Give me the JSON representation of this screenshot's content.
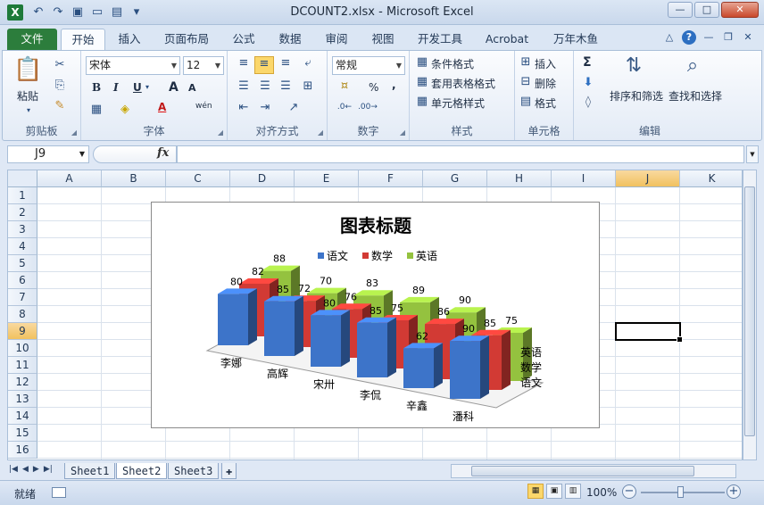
{
  "window": {
    "title": "DCOUNT2.xlsx  -  Microsoft Excel"
  },
  "ribbon_tabs": [
    "文件",
    "开始",
    "插入",
    "页面布局",
    "公式",
    "数据",
    "审阅",
    "视图",
    "开发工具",
    "Acrobat",
    "万年木鱼"
  ],
  "ribbon": {
    "clipboard": {
      "label": "剪贴板",
      "paste": "粘贴"
    },
    "font": {
      "label": "字体",
      "font_name": "宋体",
      "font_size": "12",
      "bold": "B",
      "italic": "I",
      "underline": "U",
      "grow": "A",
      "shrink": "A",
      "font_color_glyph": "A",
      "wen_glyph": "wén"
    },
    "alignment": {
      "label": "对齐方式"
    },
    "number": {
      "label": "数字",
      "format": "常规",
      "percent": "%",
      "comma": ","
    },
    "styles": {
      "label": "样式",
      "conditional": "条件格式",
      "table": "套用表格格式",
      "cell_styles": "单元格样式"
    },
    "cells": {
      "label": "单元格",
      "insert": "插入",
      "delete": "删除",
      "format": "格式"
    },
    "editing": {
      "label": "编辑",
      "sort": "排序和筛选",
      "find": "查找和选择",
      "sigma": "Σ"
    }
  },
  "formula_bar": {
    "name_box": "J9",
    "fx": "fx",
    "content": ""
  },
  "grid": {
    "columns": [
      "A",
      "B",
      "C",
      "D",
      "E",
      "F",
      "G",
      "H",
      "I",
      "J",
      "K"
    ],
    "rows": [
      "1",
      "2",
      "3",
      "4",
      "5",
      "6",
      "7",
      "8",
      "9",
      "10",
      "11",
      "12",
      "13",
      "14",
      "15",
      "16"
    ],
    "active_col": "J",
    "active_row": "9"
  },
  "chart_data": {
    "type": "bar",
    "title": "图表标题",
    "categories": [
      "李娜",
      "高辉",
      "宋卅",
      "李侃",
      "辛鑫",
      "潘科"
    ],
    "series": [
      {
        "name": "语文",
        "values": [
          80,
          85,
          80,
          85,
          62,
          90
        ],
        "color": "#3d74c9"
      },
      {
        "name": "数学",
        "values": [
          82,
          72,
          76,
          75,
          86,
          85
        ],
        "color": "#d23a34"
      },
      {
        "name": "英语",
        "values": [
          88,
          70,
          83,
          89,
          90,
          75
        ],
        "color": "#94c23f"
      }
    ],
    "depth_labels": [
      "英语",
      "数学",
      "语文"
    ],
    "legend": "top",
    "grid": false
  },
  "sheet_tabs": [
    "Sheet1",
    "Sheet2",
    "Sheet3"
  ],
  "active_sheet": "Sheet2",
  "status": {
    "ready": "就绪",
    "zoom": "100%"
  }
}
